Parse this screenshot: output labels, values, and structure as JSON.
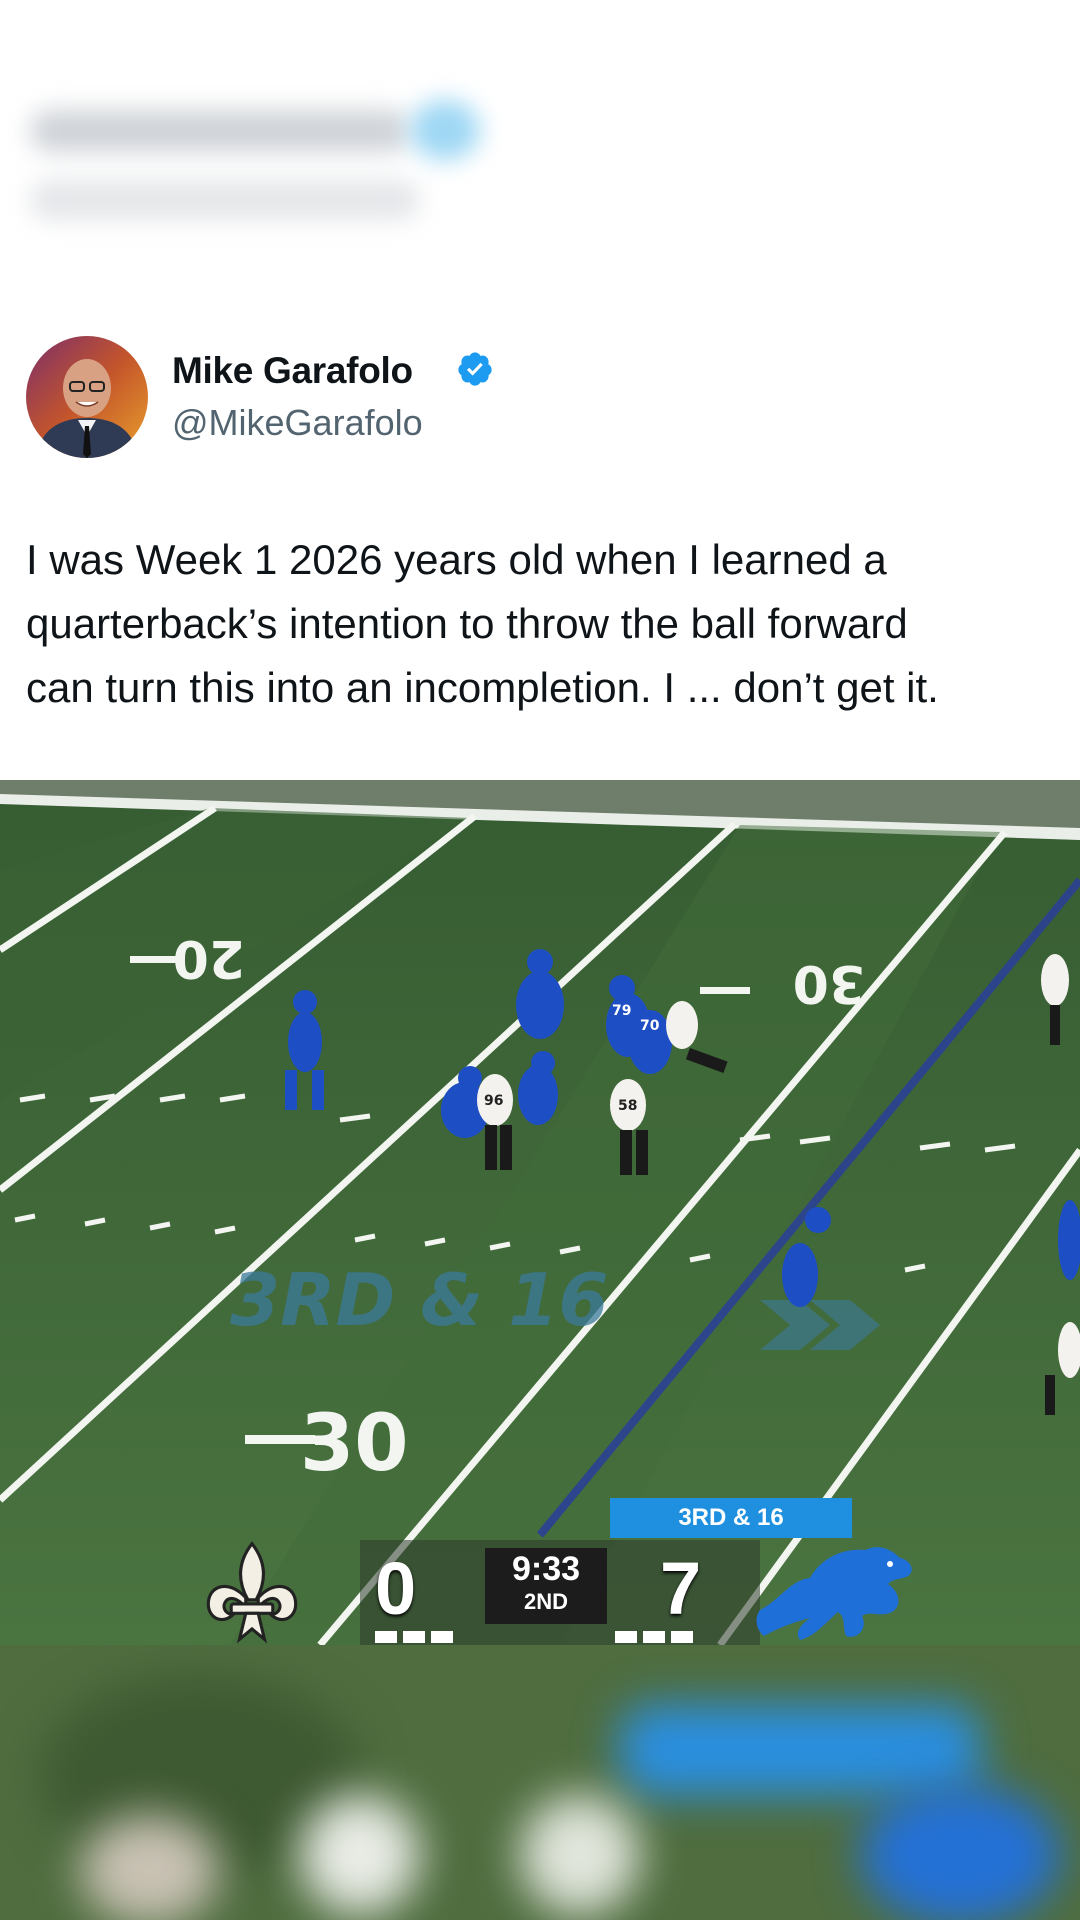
{
  "author": {
    "name": "Mike Garafolo",
    "handle": "@MikeGarafolo",
    "verified": true
  },
  "tweet": {
    "text": "I was Week 1 2026 years old when I learned a\nquarterback’s intention to throw the ball forward\ncan turn this into an incompletion. I ... don’t get it."
  },
  "media": {
    "field_overlay": "3RD & 16",
    "yard_markers": [
      "20",
      "30",
      "30"
    ],
    "jersey_numbers": [
      "96",
      "58",
      "70",
      "79"
    ],
    "scorebug": {
      "down_and_distance": "3RD & 16",
      "away_score": "0",
      "home_score": "7",
      "clock": "9:33",
      "period": "2ND",
      "away_team_icon": "fleur-de-lis-icon",
      "home_team_icon": "lion-icon"
    }
  },
  "colors": {
    "verified_blue": "#1d9bf0",
    "field_green": "#3f6a3a",
    "badge_blue": "#1f8fe0"
  }
}
